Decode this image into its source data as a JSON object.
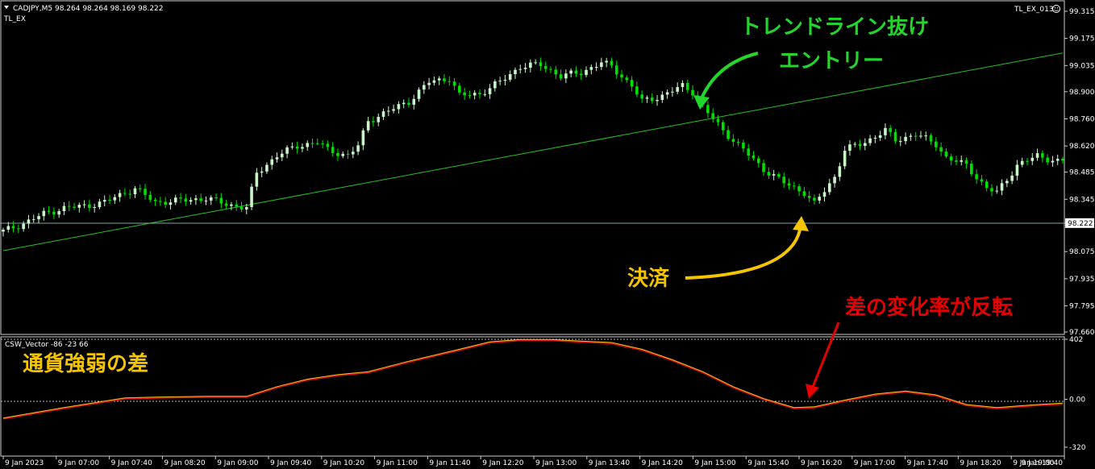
{
  "header": {
    "symbol_line": "CADJPY,M5  98.264 98.264 98.169 98.222",
    "indicator_main": "TL_EX",
    "top_right": "TL_EX_013"
  },
  "sub_window": {
    "title": "CSW_Vector -86 -23 66"
  },
  "annotations": {
    "entry_line1": "トレンドライン抜け",
    "entry_line2": "エントリー",
    "exit": "決済",
    "reversal": "差の変化率が反転",
    "strength": "通貨強弱の差"
  },
  "colors": {
    "background": "#000000",
    "bull": "#c8f5c8",
    "bear": "#00e000",
    "trendline": "#22c422",
    "bid_line": "#7fa7a7",
    "csw_red": "#e01010",
    "csw_yellow": "#f0c020",
    "arrow_green": "#22d62b",
    "arrow_yellow": "#f5c400",
    "arrow_red": "#e40000"
  },
  "chart_data": [
    {
      "type": "candlestick",
      "symbol": "CADJPY",
      "timeframe": "M5",
      "ylim": [
        97.66,
        99.315
      ],
      "y_ticks": [
        "99.315",
        "99.175",
        "99.035",
        "98.900",
        "98.760",
        "98.620",
        "98.485",
        "98.345",
        "98.222",
        "98.075",
        "97.935",
        "97.795",
        "97.660"
      ],
      "current_price": "98.222",
      "x_ticks": [
        "9 Jan 2023",
        "9 Jan 07:00",
        "9 Jan 07:40",
        "9 Jan 08:20",
        "9 Jan 09:00",
        "9 Jan 09:40",
        "9 Jan 10:20",
        "9 Jan 11:00",
        "9 Jan 11:40",
        "9 Jan 12:20",
        "9 Jan 13:00",
        "9 Jan 13:40",
        "9 Jan 14:20",
        "9 Jan 15:00",
        "9 Jan 15:40",
        "9 Jan 16:20",
        "9 Jan 17:00",
        "9 Jan 17:40",
        "9 Jan 18:20",
        "9 Jan 19:00",
        "9 Jan 19:40"
      ],
      "close_path": [
        [
          0,
          98.18
        ],
        [
          4,
          98.22
        ],
        [
          8,
          98.27
        ],
        [
          12,
          98.3
        ],
        [
          16,
          98.31
        ],
        [
          20,
          98.33
        ],
        [
          24,
          98.38
        ],
        [
          26,
          98.4
        ],
        [
          30,
          98.33
        ],
        [
          36,
          98.34
        ],
        [
          40,
          98.35
        ],
        [
          44,
          98.32
        ],
        [
          48,
          98.3
        ],
        [
          50,
          98.48
        ],
        [
          54,
          98.57
        ],
        [
          58,
          98.62
        ],
        [
          62,
          98.64
        ],
        [
          64,
          98.6
        ],
        [
          68,
          98.57
        ],
        [
          70,
          98.62
        ],
        [
          72,
          98.75
        ],
        [
          76,
          98.8
        ],
        [
          80,
          98.85
        ],
        [
          84,
          98.95
        ],
        [
          88,
          98.97
        ],
        [
          90,
          98.88
        ],
        [
          94,
          98.89
        ],
        [
          98,
          98.95
        ],
        [
          102,
          99.03
        ],
        [
          106,
          99.04
        ],
        [
          110,
          98.98
        ],
        [
          114,
          99.0
        ],
        [
          118,
          99.05
        ],
        [
          120,
          99.03
        ],
        [
          124,
          98.93
        ],
        [
          126,
          98.85
        ],
        [
          130,
          98.88
        ],
        [
          134,
          98.93
        ],
        [
          136,
          98.9
        ],
        [
          138,
          98.82
        ],
        [
          140,
          98.76
        ],
        [
          142,
          98.7
        ],
        [
          146,
          98.6
        ],
        [
          150,
          98.5
        ],
        [
          154,
          98.43
        ],
        [
          158,
          98.38
        ],
        [
          160,
          98.32
        ],
        [
          164,
          98.46
        ],
        [
          166,
          98.6
        ],
        [
          170,
          98.64
        ],
        [
          174,
          98.7
        ],
        [
          176,
          98.65
        ],
        [
          180,
          98.68
        ],
        [
          184,
          98.63
        ],
        [
          186,
          98.56
        ],
        [
          190,
          98.52
        ],
        [
          194,
          98.4
        ],
        [
          196,
          98.38
        ],
        [
          198,
          98.45
        ],
        [
          200,
          98.52
        ],
        [
          204,
          98.57
        ],
        [
          208,
          98.54
        ]
      ],
      "trendline": {
        "x": [
          0,
          209
        ],
        "y": [
          98.08,
          99.1
        ]
      }
    },
    {
      "type": "line",
      "name": "CSW_Vector",
      "ylim": [
        -320,
        402
      ],
      "y_ticks": [
        "402",
        "0.00",
        "-320"
      ],
      "x": [
        0,
        12,
        24,
        30,
        40,
        48,
        54,
        60,
        66,
        72,
        80,
        90,
        96,
        102,
        108,
        114,
        120,
        126,
        132,
        138,
        144,
        150,
        156,
        160,
        166,
        172,
        178,
        184,
        190,
        196,
        204,
        209
      ],
      "values": [
        -130,
        -60,
        5,
        10,
        15,
        15,
        80,
        130,
        160,
        180,
        250,
        330,
        380,
        395,
        395,
        385,
        375,
        330,
        260,
        180,
        80,
        0,
        -60,
        -55,
        -10,
        30,
        50,
        25,
        -40,
        -60,
        -40,
        -30
      ]
    }
  ]
}
